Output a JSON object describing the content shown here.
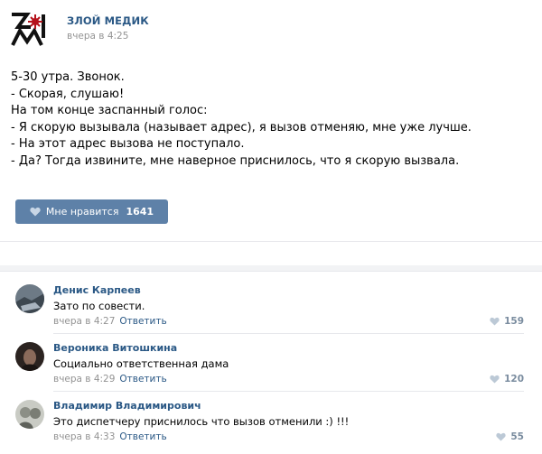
{
  "post": {
    "author": "ЗЛОЙ МЕДИК",
    "time": "вчера в 4:25",
    "lines": [
      "5-30 утра. Звонок.",
      "- Скорая, слушаю!",
      "На том конце заспанный голос:",
      "- Я скорую вызывала (называет адрес), я вызов отменяю, мне уже лучше.",
      "- На этот адрес вызова не поступало.",
      "- Да? Тогда извините, мне наверное приснилось, что я скорую вызвала."
    ],
    "like_label": "Мне нравится",
    "like_count": "1641"
  },
  "comments": [
    {
      "name": "Денис Карпеев",
      "text": "Зато по совести.",
      "time": "вчера в 4:27",
      "reply": "Ответить",
      "likes": "159"
    },
    {
      "name": "Вероника Витошкина",
      "text": "Социально ответственная дама",
      "time": "вчера в 4:29",
      "reply": "Ответить",
      "likes": "120"
    },
    {
      "name": "Владимир Владимирович",
      "text": "Это диспетчеру приснилось что вызов отменили :) !!!",
      "time": "вчера в 4:33",
      "reply": "Ответить",
      "likes": "55"
    }
  ],
  "colors": {
    "link": "#2a5885",
    "button": "#5e81a8",
    "muted": "#939393",
    "logo_red": "#b5121b"
  },
  "icons": {
    "like_button": "heart-icon",
    "comment_like": "heart-icon",
    "logo": "zm-logo"
  }
}
